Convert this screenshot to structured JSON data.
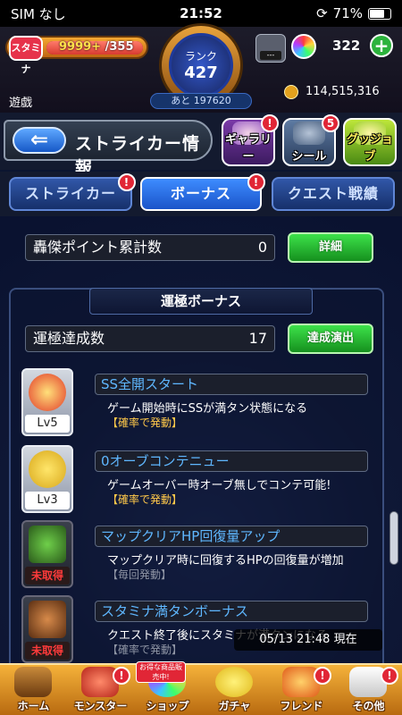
{
  "statusbar": {
    "carrier": "SIM なし",
    "time": "21:52",
    "battery": "71%"
  },
  "topbar": {
    "stamina_label": "スタミナ",
    "stamina_current": "9999+",
    "stamina_max": " /355",
    "rank_label": "ランク",
    "rank_value": "427",
    "rank_next": "あと 197620",
    "item_count": "---",
    "orb_count": "322",
    "orb_add": "+",
    "game_label": "遊戯",
    "coin_count": "114,515,316"
  },
  "header": {
    "back_arrow": "⇐",
    "title": "ストライカー情報",
    "gallery_label": "ギャラリー",
    "seal_label": "シール",
    "seal_badge": "5",
    "goods_label": "グッジョブ",
    "alert": "!"
  },
  "tabs": [
    {
      "label": "ストライカー"
    },
    {
      "label": "ボーナス"
    },
    {
      "label": "クエスト戦績"
    }
  ],
  "content": {
    "points_label": "轟傑ポイント累計数",
    "points_value": "0",
    "detail_button": "詳細",
    "panel_title": "運極ボーナス",
    "achieve_label": "運極達成数",
    "achieve_value": "17",
    "achieve_button": "達成演出",
    "timestamp": "05/13 21:48 現在",
    "bonuses": [
      {
        "name": "SS全開スタート",
        "desc": "ゲーム開始時にSSが満タン状態になる",
        "trigger": "【確率で発動】",
        "level": "Lv5",
        "icon": "go-icon"
      },
      {
        "name": "0オーブコンテニュー",
        "desc": "ゲームオーバー時オーブ無しでコンテ可能!",
        "trigger": "【確率で発動】",
        "level": "Lv3",
        "icon": "wing-arrow-icon"
      },
      {
        "name": "マップクリアHP回復量アップ",
        "desc": "マップクリア時に回復するHPの回復量が増加",
        "trigger": "【毎回発動】",
        "level": "未取得",
        "icon": "hp-icon"
      },
      {
        "name": "スタミナ満タンボーナス",
        "desc": "クエスト終了後にスタミナが満タンになる",
        "trigger": "【確率で発動】",
        "level": "未取得",
        "icon": "stamina-icon"
      }
    ]
  },
  "bottomnav": {
    "items": [
      {
        "label": "ホーム"
      },
      {
        "label": "モンスター"
      },
      {
        "label": "ショップ"
      },
      {
        "label": "ガチャ"
      },
      {
        "label": "フレンド"
      },
      {
        "label": "その他"
      }
    ],
    "promo": "お得な商品販売中!"
  },
  "colors": {
    "accent_green": "#2cb33c",
    "tab_active": "#1a54c9",
    "alert_red": "#e12636",
    "bonus_name_blue": "#5fb7ff",
    "trigger_yellow": "#ffc94a"
  }
}
